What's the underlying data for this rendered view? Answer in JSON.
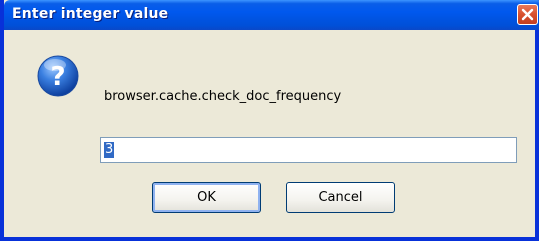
{
  "dialog": {
    "title": "Enter integer value",
    "message": "browser.cache.check_doc_frequency",
    "input_value": "3",
    "ok_label": "OK",
    "cancel_label": "Cancel",
    "icon": "question-icon",
    "close_icon": "close-icon"
  }
}
